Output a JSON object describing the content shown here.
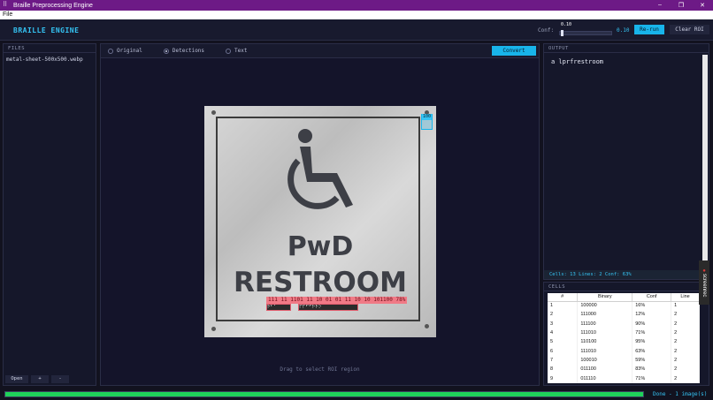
{
  "window": {
    "title": "Braille Preprocessing Engine",
    "controls": [
      "–",
      "❐",
      "✕"
    ]
  },
  "menu": {
    "file": "File"
  },
  "header": {
    "brand": "BRAILLE ENGINE",
    "conf_label": "Conf:",
    "slider_tick": "0.10",
    "conf_value": "0.10",
    "conf_fraction": 0.0,
    "rerun": "Re-run",
    "clear_roi": "Clear ROI"
  },
  "files": {
    "heading": "FILES",
    "items": [
      "metal-sheet-500x500.webp"
    ],
    "open": "Open",
    "add": "+",
    "remove": "-"
  },
  "viewer": {
    "tabs": [
      {
        "label": "Original",
        "selected": false
      },
      {
        "label": "Detections",
        "selected": true
      },
      {
        "label": "Text",
        "selected": false
      }
    ],
    "convert": "Convert",
    "sign_line1": "PwD",
    "sign_line2": "RESTROOM",
    "detection_label": "111 11 1101 11 10 01 01 11 10 10 101100 78%",
    "detection_boxes": [
      "⠗⠃⠁",
      "⠏⠏⠋⠋⠗⠗⠕"
    ],
    "corner_label": "100",
    "hint": "Drag to select ROI region"
  },
  "output": {
    "heading": "OUTPUT",
    "text": "a lprfrestroom",
    "stats": "Cells: 13   Lines: 2   Conf: 63%"
  },
  "cells": {
    "heading": "CELLS",
    "columns": [
      "#",
      "Binary",
      "Conf",
      "Line"
    ],
    "rows": [
      [
        "1",
        "100000",
        "16%",
        "1"
      ],
      [
        "2",
        "111000",
        "12%",
        "2"
      ],
      [
        "3",
        "111100",
        "90%",
        "2"
      ],
      [
        "4",
        "111010",
        "71%",
        "2"
      ],
      [
        "5",
        "110100",
        "95%",
        "2"
      ],
      [
        "6",
        "111010",
        "63%",
        "2"
      ],
      [
        "7",
        "100010",
        "59%",
        "2"
      ],
      [
        "8",
        "011100",
        "83%",
        "2"
      ],
      [
        "9",
        "011110",
        "71%",
        "2"
      ]
    ]
  },
  "watermark": "screenrec",
  "status": {
    "progress": 1.0,
    "text": "Done - 1 image(s)"
  },
  "colors": {
    "accent": "#18b4ea",
    "title_bar": "#6d1a86",
    "progress": "#1fd25a",
    "detection": "#f07a86"
  }
}
